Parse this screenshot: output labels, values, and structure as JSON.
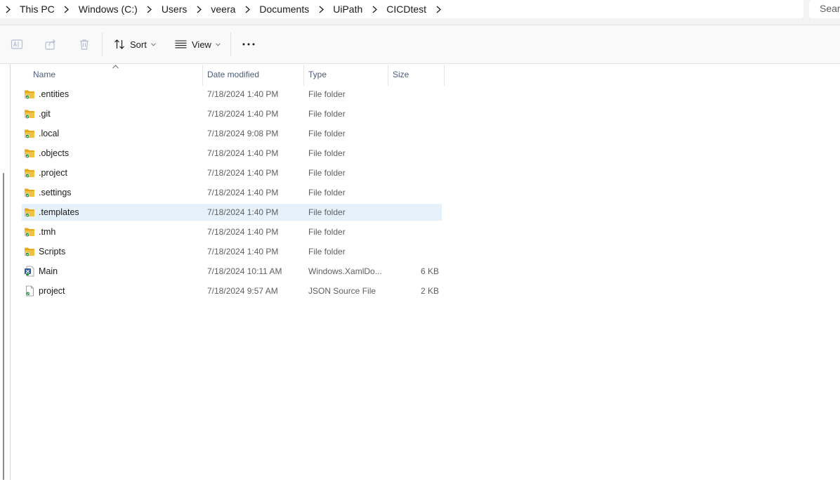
{
  "breadcrumb": {
    "items": [
      "This PC",
      "Windows (C:)",
      "Users",
      "veera",
      "Documents",
      "UiPath",
      "CICDtest"
    ]
  },
  "search": {
    "placeholder": "Search"
  },
  "toolbar": {
    "sort_label": "Sort",
    "view_label": "View",
    "icons": [
      "rename-icon",
      "share-icon",
      "delete-icon",
      "sort-icon",
      "view-icon",
      "more-icon"
    ]
  },
  "columns": {
    "name": "Name",
    "date": "Date modified",
    "type": "Type",
    "size": "Size"
  },
  "files": [
    {
      "name": ".entities",
      "date": "7/18/2024 1:40 PM",
      "type": "File folder",
      "size": "",
      "icon": "folder-icon"
    },
    {
      "name": ".git",
      "date": "7/18/2024 1:40 PM",
      "type": "File folder",
      "size": "",
      "icon": "folder-icon"
    },
    {
      "name": ".local",
      "date": "7/18/2024 9:08 PM",
      "type": "File folder",
      "size": "",
      "icon": "folder-icon"
    },
    {
      "name": ".objects",
      "date": "7/18/2024 1:40 PM",
      "type": "File folder",
      "size": "",
      "icon": "folder-icon"
    },
    {
      "name": ".project",
      "date": "7/18/2024 1:40 PM",
      "type": "File folder",
      "size": "",
      "icon": "folder-icon"
    },
    {
      "name": ".settings",
      "date": "7/18/2024 1:40 PM",
      "type": "File folder",
      "size": "",
      "icon": "folder-icon"
    },
    {
      "name": ".templates",
      "date": "7/18/2024 1:40 PM",
      "type": "File folder",
      "size": "",
      "icon": "folder-icon",
      "selected": true
    },
    {
      "name": ".tmh",
      "date": "7/18/2024 1:40 PM",
      "type": "File folder",
      "size": "",
      "icon": "folder-icon"
    },
    {
      "name": "Scripts",
      "date": "7/18/2024 1:40 PM",
      "type": "File folder",
      "size": "",
      "icon": "folder-icon"
    },
    {
      "name": "Main",
      "date": "7/18/2024 10:11 AM",
      "type": "Windows.XamlDo...",
      "size": "6 KB",
      "icon": "xaml-file-icon"
    },
    {
      "name": "project",
      "date": "7/18/2024 9:57 AM",
      "type": "JSON Source File",
      "size": "2 KB",
      "icon": "json-file-icon"
    }
  ],
  "colors": {
    "selection": "#e5f1fb",
    "folder": "#f0c244",
    "sync_badge": "#1f8f3a",
    "header_text": "#4c5d7a"
  }
}
